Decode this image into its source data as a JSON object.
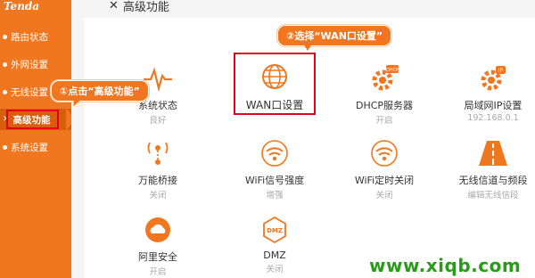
{
  "brand": {
    "logo": "Tenda"
  },
  "sidebar": {
    "items": [
      {
        "label": "路由状态"
      },
      {
        "label": "外网设置"
      },
      {
        "label": "无线设置"
      },
      {
        "label": "高级功能"
      },
      {
        "label": "系统设置"
      }
    ]
  },
  "header": {
    "title": "高级功能"
  },
  "tiles": [
    {
      "label": "系统状态",
      "sub": "良好",
      "icon": "pulse-icon"
    },
    {
      "label": "WAN口设置",
      "sub": "",
      "icon": "globe-icon"
    },
    {
      "label": "DHCP服务器",
      "sub": "开启",
      "icon": "dhcp-gear-icon"
    },
    {
      "label": "局域网IP设置",
      "sub": "192.168.0.1",
      "icon": "lan-ip-icon"
    },
    {
      "label": "万能桥接",
      "sub": "关闭",
      "icon": "bridge-icon"
    },
    {
      "label": "WiFi信号强度",
      "sub": "增强",
      "icon": "wifi-strength-icon"
    },
    {
      "label": "WiFi定时关闭",
      "sub": "关闭",
      "icon": "wifi-timer-icon"
    },
    {
      "label": "无线信道与频段",
      "sub": "编辑无线信段",
      "icon": "channel-road-icon"
    },
    {
      "label": "阿里安全",
      "sub": "开启",
      "icon": "cloud-shield-icon"
    },
    {
      "label": "DMZ",
      "sub": "关闭",
      "icon": "dmz-icon"
    }
  ],
  "annotations": {
    "step1": "①点击“高级功能”",
    "step2": "②选择“WAN口设置”"
  },
  "watermark": "www.xiqb.com",
  "colors": {
    "accent": "#f0771f",
    "highlight": "#e3001b",
    "icon": "#f0771f",
    "watermark": "#2a9a1a"
  }
}
